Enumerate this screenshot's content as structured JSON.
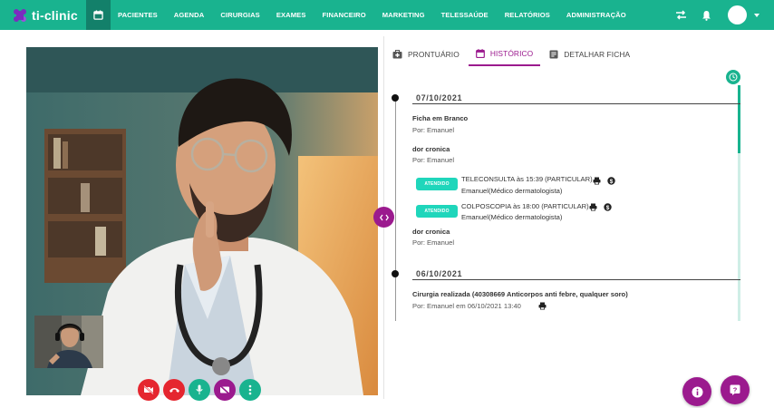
{
  "app": {
    "name": "ti-clinic"
  },
  "nav": [
    "PACIENTES",
    "AGENDA",
    "CIRURGIAS",
    "EXAMES",
    "FINANCEIRO",
    "MARKETING",
    "TELESSAÚDE",
    "RELATÓRIOS",
    "ADMINISTRAÇÃO"
  ],
  "tabs": {
    "prontuario": "PRONTUÁRIO",
    "historico": "HISTÓRICO",
    "detalhar": "DETALHAR FICHA"
  },
  "timeline": {
    "date1": "07/10/2021",
    "entry1_title": "Ficha em Branco",
    "entry1_by": "Por: Emanuel",
    "entry2_title": "dor cronica",
    "entry2_by": "Por: Emanuel",
    "appt1_badge": "ATENDIDO",
    "appt1_line1": "TELECONSULTA às 15:39 (PARTICULAR)",
    "appt1_line2": "Emanuel(Médico dermatologista)",
    "appt2_badge": "ATENDIDO",
    "appt2_line1": "COLPOSCOPIA às 18:00 (PARTICULAR)",
    "appt2_line2": "Emanuel(Médico dermatologista)",
    "entry3_title": "dor cronica",
    "entry3_by": "Por: Emanuel",
    "date2": "06/10/2021",
    "entry4_title": "Cirurgia realizada (40308669 Anticorpos anti febre, qualquer soro)",
    "entry4_by": "Por: Emanuel em 06/10/2021 13:40"
  },
  "colors": {
    "brand": "#19b38f",
    "accent": "#9b1a8e",
    "danger": "#e5262f",
    "badge": "#1fd6bb"
  },
  "icons": [
    "calendar-icon",
    "swap-icon",
    "bell-icon",
    "video-off-icon",
    "hangup-icon",
    "mic-icon",
    "screen-off-icon",
    "more-icon",
    "print-icon",
    "dollar-icon",
    "clock-icon",
    "info-icon",
    "help-icon"
  ]
}
